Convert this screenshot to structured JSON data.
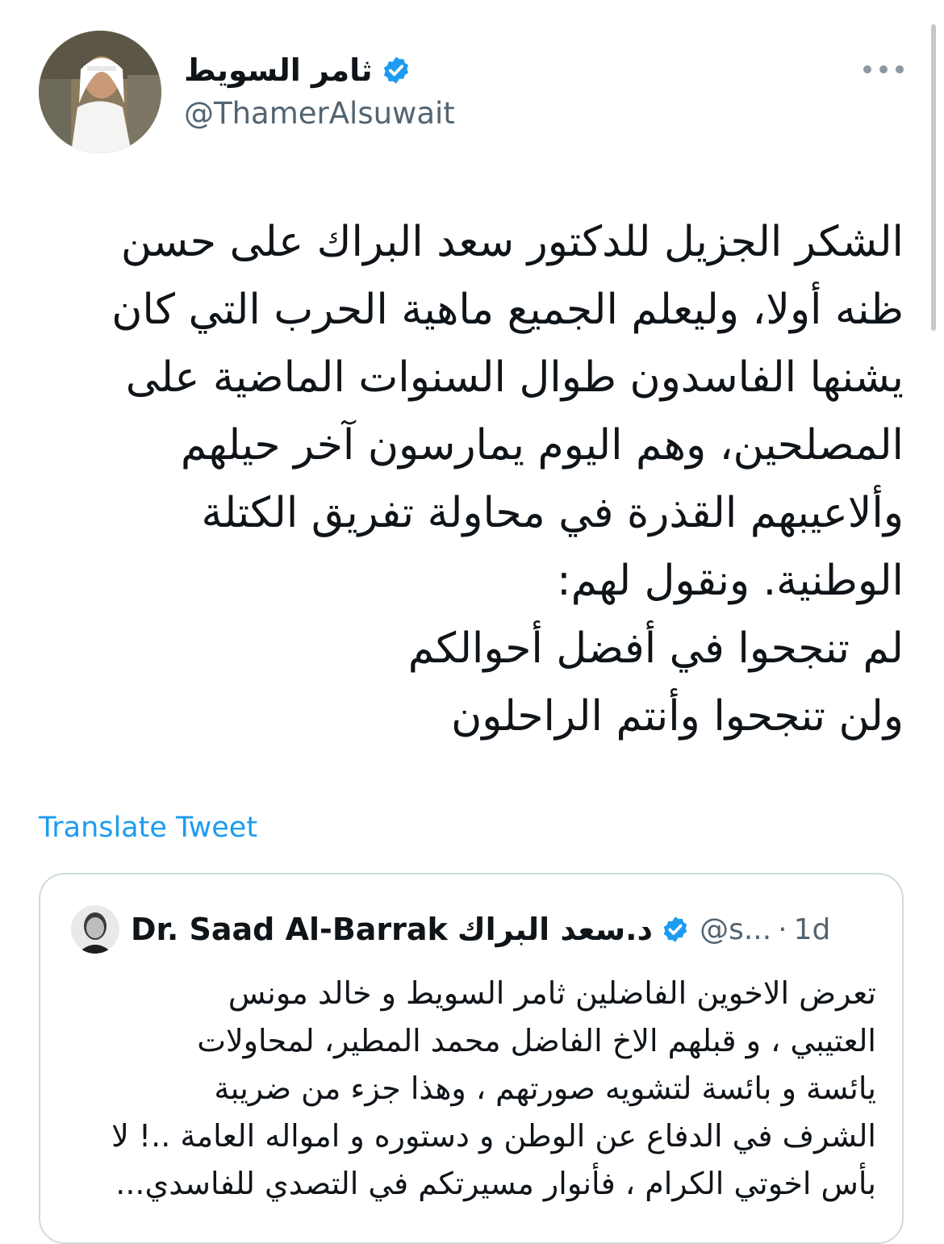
{
  "tweet": {
    "display_name": "ثامر السويط",
    "handle": "@ThamerAlsuwait",
    "verified_icon": "verified-badge-icon",
    "more_icon": "more-dots-icon",
    "body": "الشكر الجزيل للدكتور سعد البراك على حسن\nظنه أولا، وليعلم الجميع ماهية الحرب التي كان\nيشنها الفاسدون طوال السنوات الماضية على\nالمصلحين، وهم اليوم يمارسون آخر حيلهم\nوألاعيبهم القذرة في محاولة تفريق الكتلة\nالوطنية. ونقول لهم:\nلم تنجحوا في أفضل أحوالكم\nولن تنجحوا وأنتم الراحلون",
    "translate_label": "Translate Tweet"
  },
  "quote": {
    "name_latin": "Dr. Saad Al-Barrak",
    "name_arabic": "د.سعد البراك",
    "handle": "@s...",
    "separator": "·",
    "time": "1d",
    "body": "تعرض الاخوين الفاضلين ثامر السويط و خالد مونس\nالعتيبي ، و قبلهم الاخ الفاضل محمد المطير، لمحاولات\nيائسة و بائسة لتشويه صورتهم ، وهذا جزء من ضريبة\nالشرف في الدفاع عن الوطن و دستوره و امواله العامة ..! لا\nبأس اخوتي الكرام ، فأنوار مسيرتكم في التصدي للفاسدي..."
  },
  "colors": {
    "accent": "#1d9bf0",
    "secondary_text": "#536471",
    "border": "#cfd9de"
  }
}
